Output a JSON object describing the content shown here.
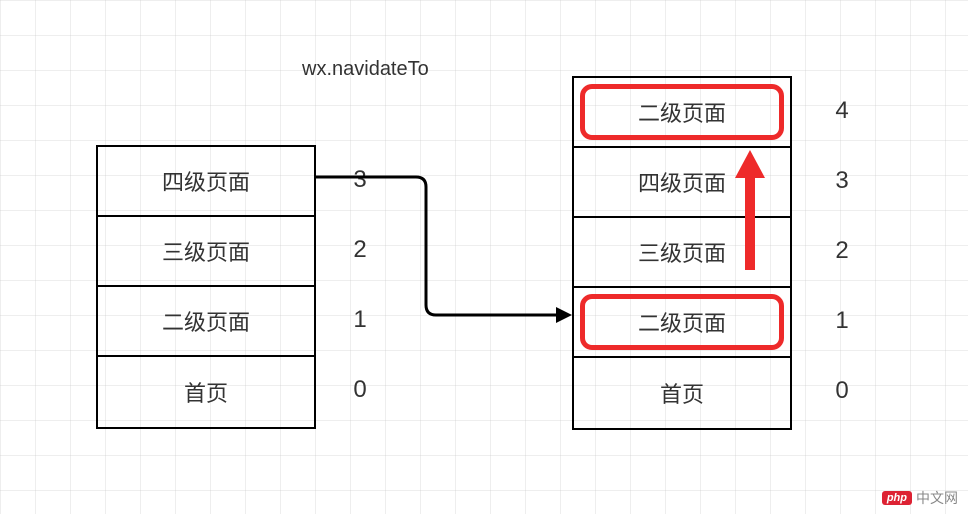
{
  "title": "wx.navidateTo",
  "leftStack": {
    "cells": [
      {
        "label": "四级页面",
        "index": "3",
        "highlighted": false
      },
      {
        "label": "三级页面",
        "index": "2",
        "highlighted": false
      },
      {
        "label": "二级页面",
        "index": "1",
        "highlighted": false
      },
      {
        "label": "首页",
        "index": "0",
        "highlighted": false
      }
    ]
  },
  "rightStack": {
    "cells": [
      {
        "label": "二级页面",
        "index": "4",
        "highlighted": true
      },
      {
        "label": "四级页面",
        "index": "3",
        "highlighted": false
      },
      {
        "label": "三级页面",
        "index": "2",
        "highlighted": false
      },
      {
        "label": "二级页面",
        "index": "1",
        "highlighted": true
      },
      {
        "label": "首页",
        "index": "0",
        "highlighted": false
      }
    ]
  },
  "watermark": {
    "badge": "php",
    "text": "中文网"
  },
  "colors": {
    "highlight": "#ee2a2a",
    "border": "#000000",
    "text": "#333333"
  }
}
